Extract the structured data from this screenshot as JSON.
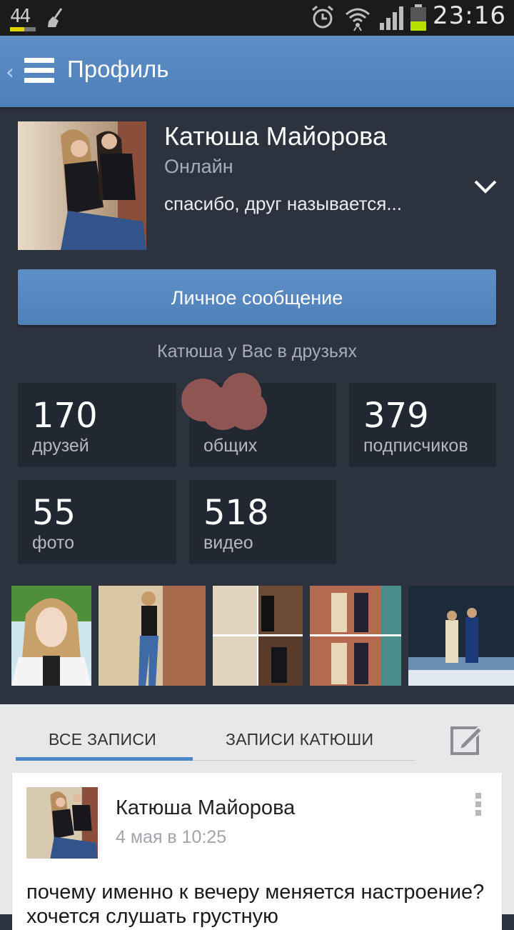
{
  "status_bar": {
    "notification_text": "44",
    "time": "23:16",
    "icons": [
      "notification-count-icon",
      "broom-icon",
      "alarm-icon",
      "wifi-icon",
      "signal-icon",
      "battery-icon"
    ]
  },
  "header": {
    "title": "Профиль",
    "back_glyph": "‹",
    "menu_icon": "hamburger-icon"
  },
  "profile": {
    "name": "Катюша Майорова",
    "presence": "Онлайн",
    "status": "спасибо, друг называется...",
    "message_button": "Личное сообщение",
    "friend_note": "Катюша у Вас в друзьях"
  },
  "stats": [
    {
      "value": "170",
      "label": "друзей"
    },
    {
      "value": "",
      "label": "общих"
    },
    {
      "value": "379",
      "label": "подписчиков"
    },
    {
      "value": "55",
      "label": "фото"
    },
    {
      "value": "518",
      "label": "видео"
    }
  ],
  "wall": {
    "tabs": [
      {
        "label": "ВСЕ ЗАПИСИ",
        "active": true
      },
      {
        "label": "ЗАПИСИ КАТЮШИ",
        "active": false
      }
    ],
    "post": {
      "author": "Катюша Майорова",
      "date": "4 мая в 10:25",
      "text": "почему именно к вечеру меняется настроение? хочется слушать грустную"
    }
  },
  "colors": {
    "accent": "#4f80b9",
    "background": "#2c323e",
    "stat_tile": "#222832",
    "wall_bg": "#e7e8ea",
    "tab_active": "#4a88c8"
  }
}
